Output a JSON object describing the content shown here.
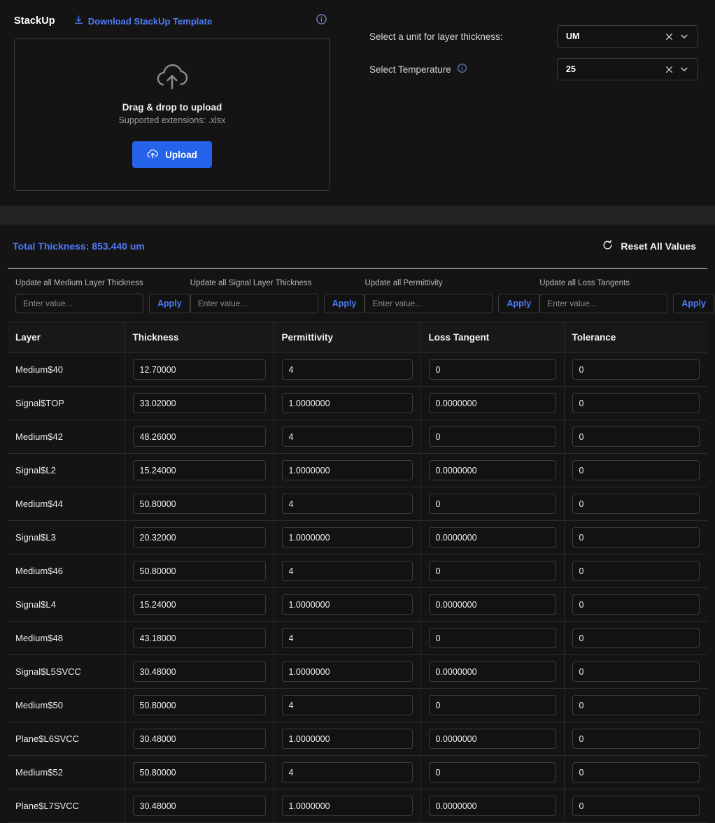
{
  "stackup": {
    "title": "StackUp",
    "download_label": "Download StackUp Template",
    "dropzone": {
      "title": "Drag & drop to upload",
      "subtitle": "Supported extensions: .xlsx",
      "upload_label": "Upload"
    }
  },
  "settings": {
    "unit": {
      "label": "Select a unit for layer thickness:",
      "value": "UM"
    },
    "temperature": {
      "label": "Select Temperature",
      "value": "25"
    }
  },
  "totals": {
    "total_thickness": "Total Thickness: 853.440 um",
    "reset_label": "Reset All Values"
  },
  "updates": [
    {
      "label": "Update all Medium Layer Thickness",
      "placeholder": "Enter value...",
      "value": "",
      "apply_label": "Apply"
    },
    {
      "label": "Update all Signal Layer Thickness",
      "placeholder": "Enter value...",
      "value": "",
      "apply_label": "Apply"
    },
    {
      "label": "Update all Permittivity",
      "placeholder": "Enter value...",
      "value": "",
      "apply_label": "Apply"
    },
    {
      "label": "Update all Loss Tangents",
      "placeholder": "Enter value...",
      "value": "",
      "apply_label": "Apply"
    }
  ],
  "table": {
    "columns": [
      "Layer",
      "Thickness",
      "Permittivity",
      "Loss Tangent",
      "Tolerance"
    ],
    "rows": [
      {
        "layer": "Medium$40",
        "thickness": "12.70000",
        "permittivity": "4",
        "loss_tangent": "0",
        "tolerance": "0"
      },
      {
        "layer": "Signal$TOP",
        "thickness": "33.02000",
        "permittivity": "1.0000000",
        "loss_tangent": "0.0000000",
        "tolerance": "0"
      },
      {
        "layer": "Medium$42",
        "thickness": "48.26000",
        "permittivity": "4",
        "loss_tangent": "0",
        "tolerance": "0"
      },
      {
        "layer": "Signal$L2",
        "thickness": "15.24000",
        "permittivity": "1.0000000",
        "loss_tangent": "0.0000000",
        "tolerance": "0"
      },
      {
        "layer": "Medium$44",
        "thickness": "50.80000",
        "permittivity": "4",
        "loss_tangent": "0",
        "tolerance": "0"
      },
      {
        "layer": "Signal$L3",
        "thickness": "20.32000",
        "permittivity": "1.0000000",
        "loss_tangent": "0.0000000",
        "tolerance": "0"
      },
      {
        "layer": "Medium$46",
        "thickness": "50.80000",
        "permittivity": "4",
        "loss_tangent": "0",
        "tolerance": "0"
      },
      {
        "layer": "Signal$L4",
        "thickness": "15.24000",
        "permittivity": "1.0000000",
        "loss_tangent": "0.0000000",
        "tolerance": "0"
      },
      {
        "layer": "Medium$48",
        "thickness": "43.18000",
        "permittivity": "4",
        "loss_tangent": "0",
        "tolerance": "0"
      },
      {
        "layer": "Signal$L5SVCC",
        "thickness": "30.48000",
        "permittivity": "1.0000000",
        "loss_tangent": "0.0000000",
        "tolerance": "0"
      },
      {
        "layer": "Medium$50",
        "thickness": "50.80000",
        "permittivity": "4",
        "loss_tangent": "0",
        "tolerance": "0"
      },
      {
        "layer": "Plane$L6SVCC",
        "thickness": "30.48000",
        "permittivity": "1.0000000",
        "loss_tangent": "0.0000000",
        "tolerance": "0"
      },
      {
        "layer": "Medium$52",
        "thickness": "50.80000",
        "permittivity": "4",
        "loss_tangent": "0",
        "tolerance": "0"
      },
      {
        "layer": "Plane$L7SVCC",
        "thickness": "30.48000",
        "permittivity": "1.0000000",
        "loss_tangent": "0.0000000",
        "tolerance": "0"
      }
    ]
  },
  "colors": {
    "accent_blue": "#4d7cf7",
    "upload_button": "#2563eb",
    "page_bg": "#242424",
    "panel_bg": "#141414"
  }
}
